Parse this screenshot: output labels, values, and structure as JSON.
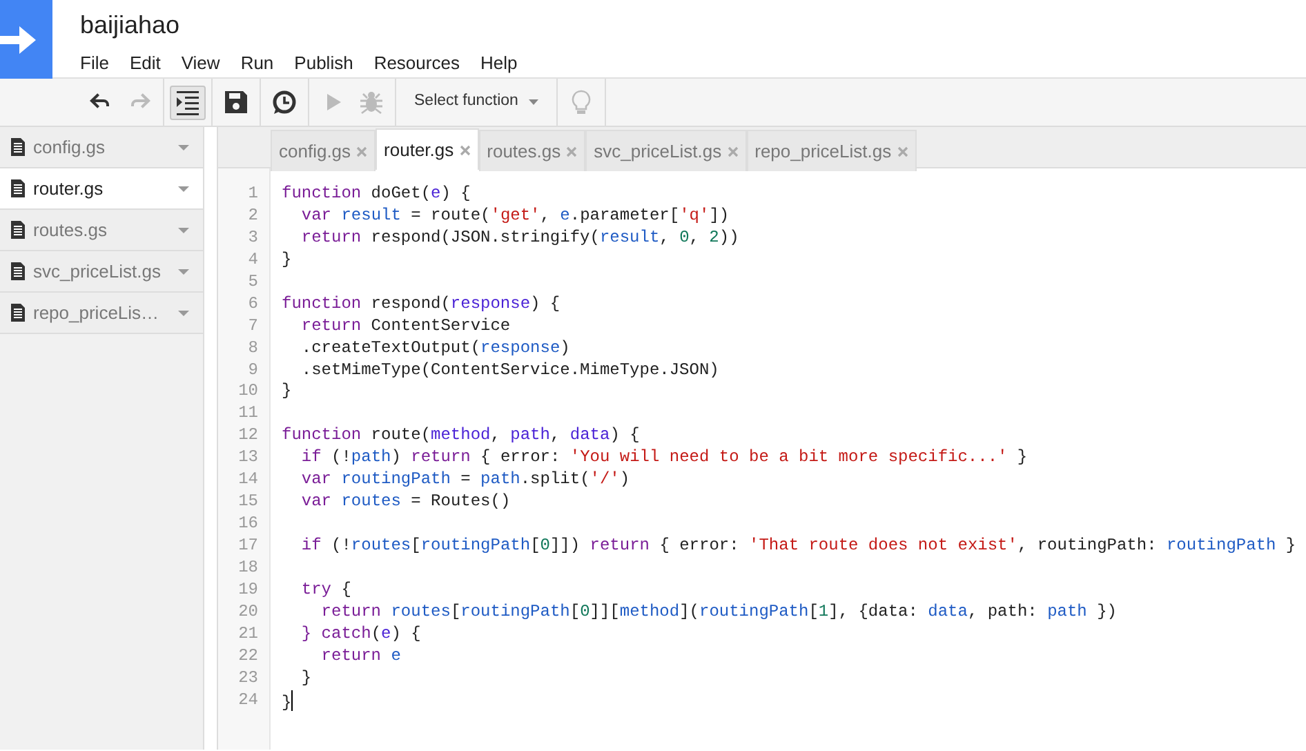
{
  "header": {
    "title": "baijiahao",
    "menu": [
      "File",
      "Edit",
      "View",
      "Run",
      "Publish",
      "Resources",
      "Help"
    ]
  },
  "toolbar": {
    "buttons": [
      {
        "kind": "undo",
        "disabled": false,
        "pressed": false
      },
      {
        "kind": "redo",
        "disabled": true,
        "pressed": false
      },
      {
        "kind": "indent",
        "disabled": false,
        "pressed": true
      },
      {
        "kind": "save",
        "disabled": false,
        "pressed": false
      },
      {
        "kind": "triggers",
        "disabled": false,
        "pressed": false
      },
      {
        "kind": "run",
        "disabled": true,
        "pressed": false
      },
      {
        "kind": "debug",
        "disabled": true,
        "pressed": false
      },
      {
        "kind": "select",
        "label": "Select function",
        "disabled": false,
        "pressed": false
      },
      {
        "kind": "hint",
        "disabled": true,
        "pressed": false
      }
    ]
  },
  "sidebar": {
    "files": [
      {
        "name": "config.gs",
        "selected": false
      },
      {
        "name": "router.gs",
        "selected": true
      },
      {
        "name": "routes.gs",
        "selected": false
      },
      {
        "name": "svc_priceList.gs",
        "selected": false
      },
      {
        "name": "repo_priceLis…",
        "selected": false
      }
    ]
  },
  "tabs": [
    {
      "label": "config.gs",
      "selected": false
    },
    {
      "label": "router.gs",
      "selected": true
    },
    {
      "label": "routes.gs",
      "selected": false
    },
    {
      "label": "svc_priceList.gs",
      "selected": false
    },
    {
      "label": "repo_priceList.gs",
      "selected": false
    }
  ],
  "editor": {
    "lines": [
      {
        "number": "1",
        "cursor": false,
        "tokens": [
          {
            "text": "function",
            "kind": "keyword"
          },
          {
            "text": " doGet(",
            "kind": "plain"
          },
          {
            "text": "e",
            "kind": "param"
          },
          {
            "text": ") {",
            "kind": "plain"
          }
        ]
      },
      {
        "number": "2",
        "cursor": false,
        "tokens": [
          {
            "text": "  var",
            "kind": "keyword"
          },
          {
            "text": " result",
            "kind": "variable"
          },
          {
            "text": " = route(",
            "kind": "plain"
          },
          {
            "text": "'get'",
            "kind": "string"
          },
          {
            "text": ", ",
            "kind": "plain"
          },
          {
            "text": "e",
            "kind": "variable"
          },
          {
            "text": ".parameter[",
            "kind": "plain"
          },
          {
            "text": "'q'",
            "kind": "string"
          },
          {
            "text": "])",
            "kind": "plain"
          }
        ]
      },
      {
        "number": "3",
        "cursor": false,
        "tokens": [
          {
            "text": "  return",
            "kind": "keyword"
          },
          {
            "text": " respond(JSON.stringify(",
            "kind": "plain"
          },
          {
            "text": "result",
            "kind": "variable"
          },
          {
            "text": ", ",
            "kind": "plain"
          },
          {
            "text": "0",
            "kind": "number"
          },
          {
            "text": ", ",
            "kind": "plain"
          },
          {
            "text": "2",
            "kind": "number"
          },
          {
            "text": "))",
            "kind": "plain"
          }
        ]
      },
      {
        "number": "4",
        "cursor": false,
        "tokens": [
          {
            "text": "}",
            "kind": "plain"
          }
        ]
      },
      {
        "number": "5",
        "cursor": false
      },
      {
        "number": "6",
        "cursor": false,
        "tokens": [
          {
            "text": "function",
            "kind": "keyword"
          },
          {
            "text": " respond(",
            "kind": "plain"
          },
          {
            "text": "response",
            "kind": "param"
          },
          {
            "text": ") {",
            "kind": "plain"
          }
        ]
      },
      {
        "number": "7",
        "cursor": false,
        "tokens": [
          {
            "text": "  return",
            "kind": "keyword"
          },
          {
            "text": " ContentService",
            "kind": "plain"
          }
        ]
      },
      {
        "number": "8",
        "cursor": false,
        "tokens": [
          {
            "text": "  .createTextOutput(",
            "kind": "plain"
          },
          {
            "text": "response",
            "kind": "variable"
          },
          {
            "text": ")",
            "kind": "plain"
          }
        ]
      },
      {
        "number": "9",
        "cursor": false,
        "tokens": [
          {
            "text": "  .setMimeType(ContentService.MimeType.JSON)",
            "kind": "plain"
          }
        ]
      },
      {
        "number": "10",
        "cursor": false,
        "tokens": [
          {
            "text": "}",
            "kind": "plain"
          }
        ]
      },
      {
        "number": "11",
        "cursor": false
      },
      {
        "number": "12",
        "cursor": false,
        "tokens": [
          {
            "text": "function",
            "kind": "keyword"
          },
          {
            "text": " route(",
            "kind": "plain"
          },
          {
            "text": "method",
            "kind": "param"
          },
          {
            "text": ", ",
            "kind": "plain"
          },
          {
            "text": "path",
            "kind": "param"
          },
          {
            "text": ", ",
            "kind": "plain"
          },
          {
            "text": "data",
            "kind": "param"
          },
          {
            "text": ") {",
            "kind": "plain"
          }
        ]
      },
      {
        "number": "13",
        "cursor": false,
        "tokens": [
          {
            "text": "  if",
            "kind": "keyword"
          },
          {
            "text": " (!",
            "kind": "plain"
          },
          {
            "text": "path",
            "kind": "variable"
          },
          {
            "text": ") ",
            "kind": "plain"
          },
          {
            "text": "return",
            "kind": "keyword"
          },
          {
            "text": " { error: ",
            "kind": "plain"
          },
          {
            "text": "'You will need to be a bit more specific...'",
            "kind": "string"
          },
          {
            "text": " }",
            "kind": "plain"
          }
        ]
      },
      {
        "number": "14",
        "cursor": false,
        "tokens": [
          {
            "text": "  var",
            "kind": "keyword"
          },
          {
            "text": " routingPath",
            "kind": "variable"
          },
          {
            "text": " = ",
            "kind": "plain"
          },
          {
            "text": "path",
            "kind": "variable"
          },
          {
            "text": ".split(",
            "kind": "plain"
          },
          {
            "text": "'/'",
            "kind": "string"
          },
          {
            "text": ")",
            "kind": "plain"
          }
        ]
      },
      {
        "number": "15",
        "cursor": false,
        "tokens": [
          {
            "text": "  var",
            "kind": "keyword"
          },
          {
            "text": " routes",
            "kind": "variable"
          },
          {
            "text": " = Routes()",
            "kind": "plain"
          }
        ]
      },
      {
        "number": "16",
        "cursor": false
      },
      {
        "number": "17",
        "cursor": false,
        "tokens": [
          {
            "text": "  if",
            "kind": "keyword"
          },
          {
            "text": " (!",
            "kind": "plain"
          },
          {
            "text": "routes",
            "kind": "variable"
          },
          {
            "text": "[",
            "kind": "plain"
          },
          {
            "text": "routingPath",
            "kind": "variable"
          },
          {
            "text": "[",
            "kind": "plain"
          },
          {
            "text": "0",
            "kind": "number"
          },
          {
            "text": "]]) ",
            "kind": "plain"
          },
          {
            "text": "return",
            "kind": "keyword"
          },
          {
            "text": " { error: ",
            "kind": "plain"
          },
          {
            "text": "'That route does not exist'",
            "kind": "string"
          },
          {
            "text": ", routingPath: ",
            "kind": "plain"
          },
          {
            "text": "routingPath",
            "kind": "variable"
          },
          {
            "text": " }",
            "kind": "plain"
          }
        ]
      },
      {
        "number": "18",
        "cursor": false
      },
      {
        "number": "19",
        "cursor": false,
        "tokens": [
          {
            "text": "  try",
            "kind": "keyword"
          },
          {
            "text": " {",
            "kind": "plain"
          }
        ]
      },
      {
        "number": "20",
        "cursor": false,
        "tokens": [
          {
            "text": "    return",
            "kind": "keyword"
          },
          {
            "text": " routes",
            "kind": "variable"
          },
          {
            "text": "[",
            "kind": "plain"
          },
          {
            "text": "routingPath",
            "kind": "variable"
          },
          {
            "text": "[",
            "kind": "plain"
          },
          {
            "text": "0",
            "kind": "number"
          },
          {
            "text": "]][",
            "kind": "plain"
          },
          {
            "text": "method",
            "kind": "variable"
          },
          {
            "text": "](",
            "kind": "plain"
          },
          {
            "text": "routingPath",
            "kind": "variable"
          },
          {
            "text": "[",
            "kind": "plain"
          },
          {
            "text": "1",
            "kind": "number"
          },
          {
            "text": "], {data: ",
            "kind": "plain"
          },
          {
            "text": "data",
            "kind": "variable"
          },
          {
            "text": ", path: ",
            "kind": "plain"
          },
          {
            "text": "path",
            "kind": "variable"
          },
          {
            "text": " })",
            "kind": "plain"
          }
        ]
      },
      {
        "number": "21",
        "cursor": false,
        "tokens": [
          {
            "text": "  } catch",
            "kind": "keyword"
          },
          {
            "text": "(",
            "kind": "plain"
          },
          {
            "text": "e",
            "kind": "param"
          },
          {
            "text": ") {",
            "kind": "plain"
          }
        ]
      },
      {
        "number": "22",
        "cursor": false,
        "tokens": [
          {
            "text": "    return",
            "kind": "keyword"
          },
          {
            "text": " e",
            "kind": "variable"
          }
        ]
      },
      {
        "number": "23",
        "cursor": false,
        "tokens": [
          {
            "text": "  }",
            "kind": "plain"
          }
        ]
      },
      {
        "number": "24",
        "cursor": true,
        "tokens": [
          {
            "text": "}",
            "kind": "plain"
          }
        ]
      }
    ]
  }
}
